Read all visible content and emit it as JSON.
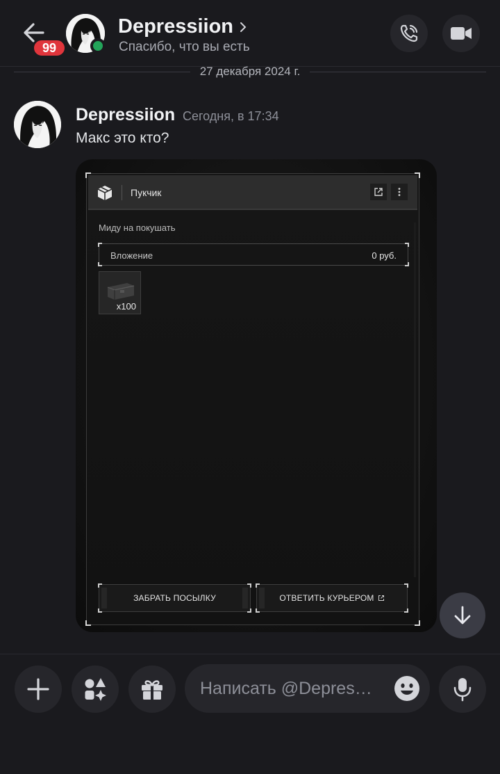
{
  "header": {
    "unread_count": "99",
    "name": "Depressiion",
    "status_text": "Спасибо, что вы есть"
  },
  "date_separator": "27 декабря 2024 г.",
  "message": {
    "author": "Depressiion",
    "timestamp": "Сегодня, в 17:34",
    "text": "Макс это кто?"
  },
  "attachment": {
    "panel_title": "Пукчик",
    "subtitle": "Миду на покушать",
    "field_label": "Вложение",
    "field_value": "0 руб.",
    "item_qty": "x100",
    "btn_take": "ЗАБРАТЬ ПОСЫЛКУ",
    "btn_reply": "ОТВЕТИТЬ КУРЬЕРОМ"
  },
  "composer": {
    "placeholder": "Написать @Depressiion"
  },
  "colors": {
    "background": "#1a1a1e",
    "button_bg": "#26262b",
    "badge_red": "#e0353c",
    "online_green": "#23a55a"
  },
  "icons": {
    "back": "arrow-left-icon",
    "chevron": "chevron-right-icon",
    "call": "phone-call-icon",
    "video": "video-camera-icon",
    "scroll_down": "arrow-down-icon",
    "add": "plus-icon",
    "apps": "apps-shapes-icon",
    "gift": "gift-icon",
    "emoji": "emoji-smile-icon",
    "mic": "microphone-icon"
  }
}
